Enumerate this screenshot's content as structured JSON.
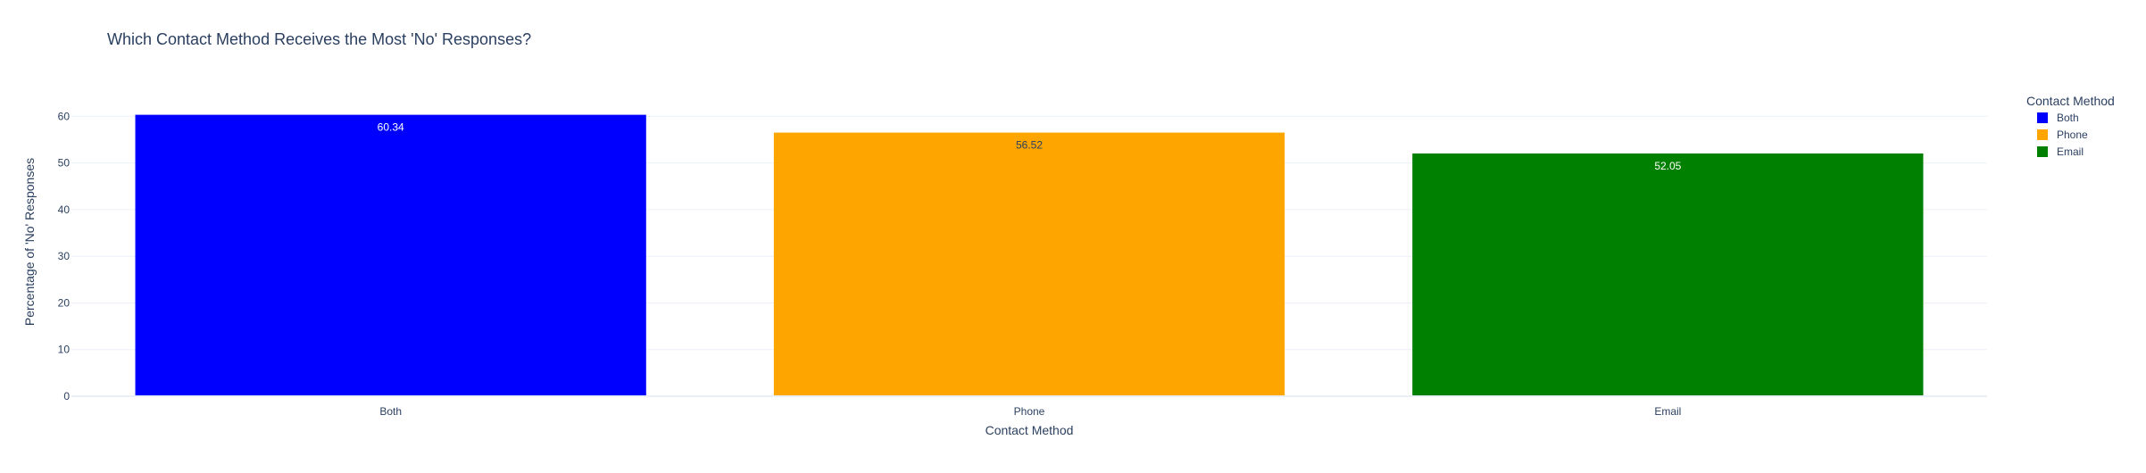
{
  "chart_data": {
    "type": "bar",
    "title": "Which Contact Method Receives the Most 'No' Responses?",
    "xlabel": "Contact Method",
    "ylabel": "Percentage of 'No' Responses",
    "categories": [
      "Both",
      "Phone",
      "Email"
    ],
    "values": [
      60.34,
      56.52,
      52.05
    ],
    "data_labels": [
      "60.34",
      "56.52",
      "52.05"
    ],
    "colors": [
      "#0000ff",
      "#ffa500",
      "#008000"
    ],
    "label_colors": [
      "#ffffff",
      "#2a3f5f",
      "#ffffff"
    ],
    "ylim": [
      0,
      63.52
    ],
    "yticks": [
      0,
      10,
      20,
      30,
      40,
      50,
      60
    ],
    "grid": true,
    "legend": {
      "title": "Contact Method",
      "placement": "top-right",
      "entries": [
        "Both",
        "Phone",
        "Email"
      ]
    }
  }
}
